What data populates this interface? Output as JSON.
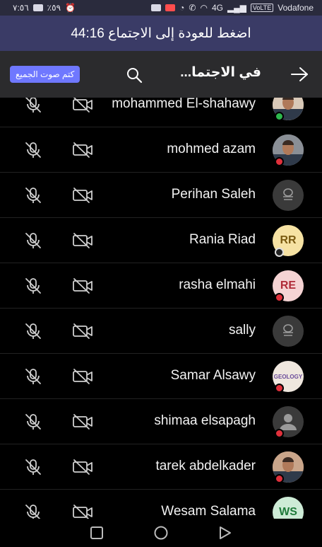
{
  "status_bar": {
    "time": "٧:٥٦",
    "battery": "٪٥٩",
    "network": "4G",
    "volte": "VoLTE",
    "carrier": "Vodafone"
  },
  "call_banner": {
    "text": "اضغط للعودة إلى الاجتماع 44:16"
  },
  "header": {
    "title": "في الاجتما...",
    "mute_all_label": "كتم صوت الجميع",
    "search_icon": "search-icon",
    "back_icon": "arrow-right-icon"
  },
  "colors": {
    "accent": "#6f78ff",
    "banner": "#3a3b66",
    "online": "#2db84d",
    "busy": "#e0303b"
  },
  "participants": [
    {
      "name": "mohammed El-shahawy",
      "initials": "",
      "avatar": "photo",
      "avatar_bg": "#d9c9b8",
      "status": "online"
    },
    {
      "name": "mohmed azam",
      "initials": "",
      "avatar": "photo",
      "avatar_bg": "#8a8f96",
      "status": "busy"
    },
    {
      "name": "Perihan Saleh",
      "initials": "",
      "avatar": "generic",
      "avatar_bg": "#3a3a3a",
      "status": ""
    },
    {
      "name": "Rania Riad",
      "initials": "RR",
      "avatar": "initials",
      "avatar_bg": "#f6e2a3",
      "initials_color": "#7a5a10",
      "status": "away"
    },
    {
      "name": "rasha elmahi",
      "initials": "RE",
      "avatar": "initials",
      "avatar_bg": "#f5d3d3",
      "initials_color": "#b02a37",
      "status": "busy"
    },
    {
      "name": "sally",
      "initials": "",
      "avatar": "generic",
      "avatar_bg": "#3a3a3a",
      "status": ""
    },
    {
      "name": "Samar Alsawy",
      "initials": "",
      "avatar": "logo",
      "avatar_bg": "#efe7de",
      "status": "busy",
      "logo_text": "GEOLOGY"
    },
    {
      "name": "shimaa elsapagh",
      "initials": "",
      "avatar": "person",
      "avatar_bg": "#3a3a3a",
      "status": "busy"
    },
    {
      "name": "tarek abdelkader",
      "initials": "",
      "avatar": "photo",
      "avatar_bg": "#c9a58a",
      "status": "busy"
    },
    {
      "name": "Wesam Salama",
      "initials": "WS",
      "avatar": "initials",
      "avatar_bg": "#cdebd6",
      "initials_color": "#1f7a3a",
      "status": "busy"
    }
  ]
}
